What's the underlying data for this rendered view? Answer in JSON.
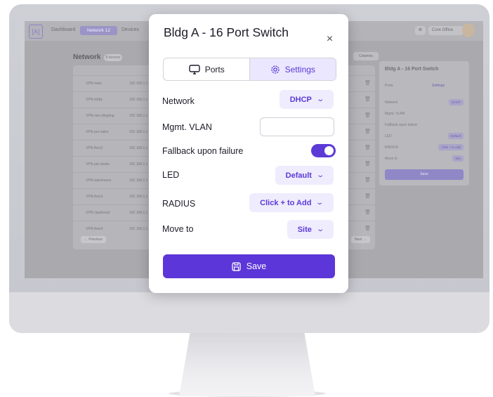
{
  "app": {
    "nav": {
      "dashboard": "Dashboard",
      "network": "Network",
      "network_count": "12",
      "devices": "Devices",
      "org": "Core Office"
    },
    "page_title": "Network",
    "page_badge": "8 devices",
    "columns_label": "Columns",
    "rows": [
      {
        "name": "VPN-main",
        "ip": "192.168.1.1"
      },
      {
        "name": "VPN-lobby",
        "ip": "192.168.1.1"
      },
      {
        "name": "VPN-non-shipping",
        "ip": "192.168.1.1"
      },
      {
        "name": "VPN-pre-sales",
        "ip": "192.168.1.1"
      },
      {
        "name": "VPN-floor2",
        "ip": "192.168.1.1"
      },
      {
        "name": "VPN-pre-studio",
        "ip": "192.168.1.1"
      },
      {
        "name": "VPN-warehouse",
        "ip": "192.168.1.1"
      },
      {
        "name": "VPN-floor3",
        "ip": "192.168.1.1"
      },
      {
        "name": "VPN-OpsArea3",
        "ip": "192.168.1.1"
      },
      {
        "name": "VPN-floor4",
        "ip": "192.168.1.1"
      }
    ],
    "previous": "← Previous",
    "next": "Next →",
    "side": {
      "title": "Bldg A - 16 Port Switch",
      "ports": "Ports",
      "settings": "Settings",
      "network": "Network",
      "network_val": "DHCP",
      "vlan": "Mgmt. VLAN",
      "fallback": "Fallback upon failure",
      "led": "LED",
      "led_val": "Default",
      "radius": "RADIUS",
      "radius_val": "Click + to Add",
      "move": "Move to",
      "move_val": "Site",
      "save": "Save"
    }
  },
  "modal": {
    "title": "Bldg A - 16 Port Switch",
    "tabs": [
      {
        "label": "Ports",
        "icon": "monitor-icon",
        "active": false
      },
      {
        "label": "Settings",
        "icon": "gear-icon",
        "active": true
      }
    ],
    "network": {
      "label": "Network",
      "value": "DHCP"
    },
    "vlan": {
      "label": "Mgmt. VLAN",
      "value": ""
    },
    "fallback": {
      "label": "Fallback upon failure",
      "enabled": true
    },
    "led": {
      "label": "LED",
      "value": "Default"
    },
    "radius": {
      "label": "RADIUS",
      "value": "Click + to Add"
    },
    "move_to": {
      "label": "Move to",
      "value": "Site"
    },
    "save_label": "Save"
  },
  "colors": {
    "accent": "#5C36D8",
    "accent_light": "#EFECFE"
  }
}
